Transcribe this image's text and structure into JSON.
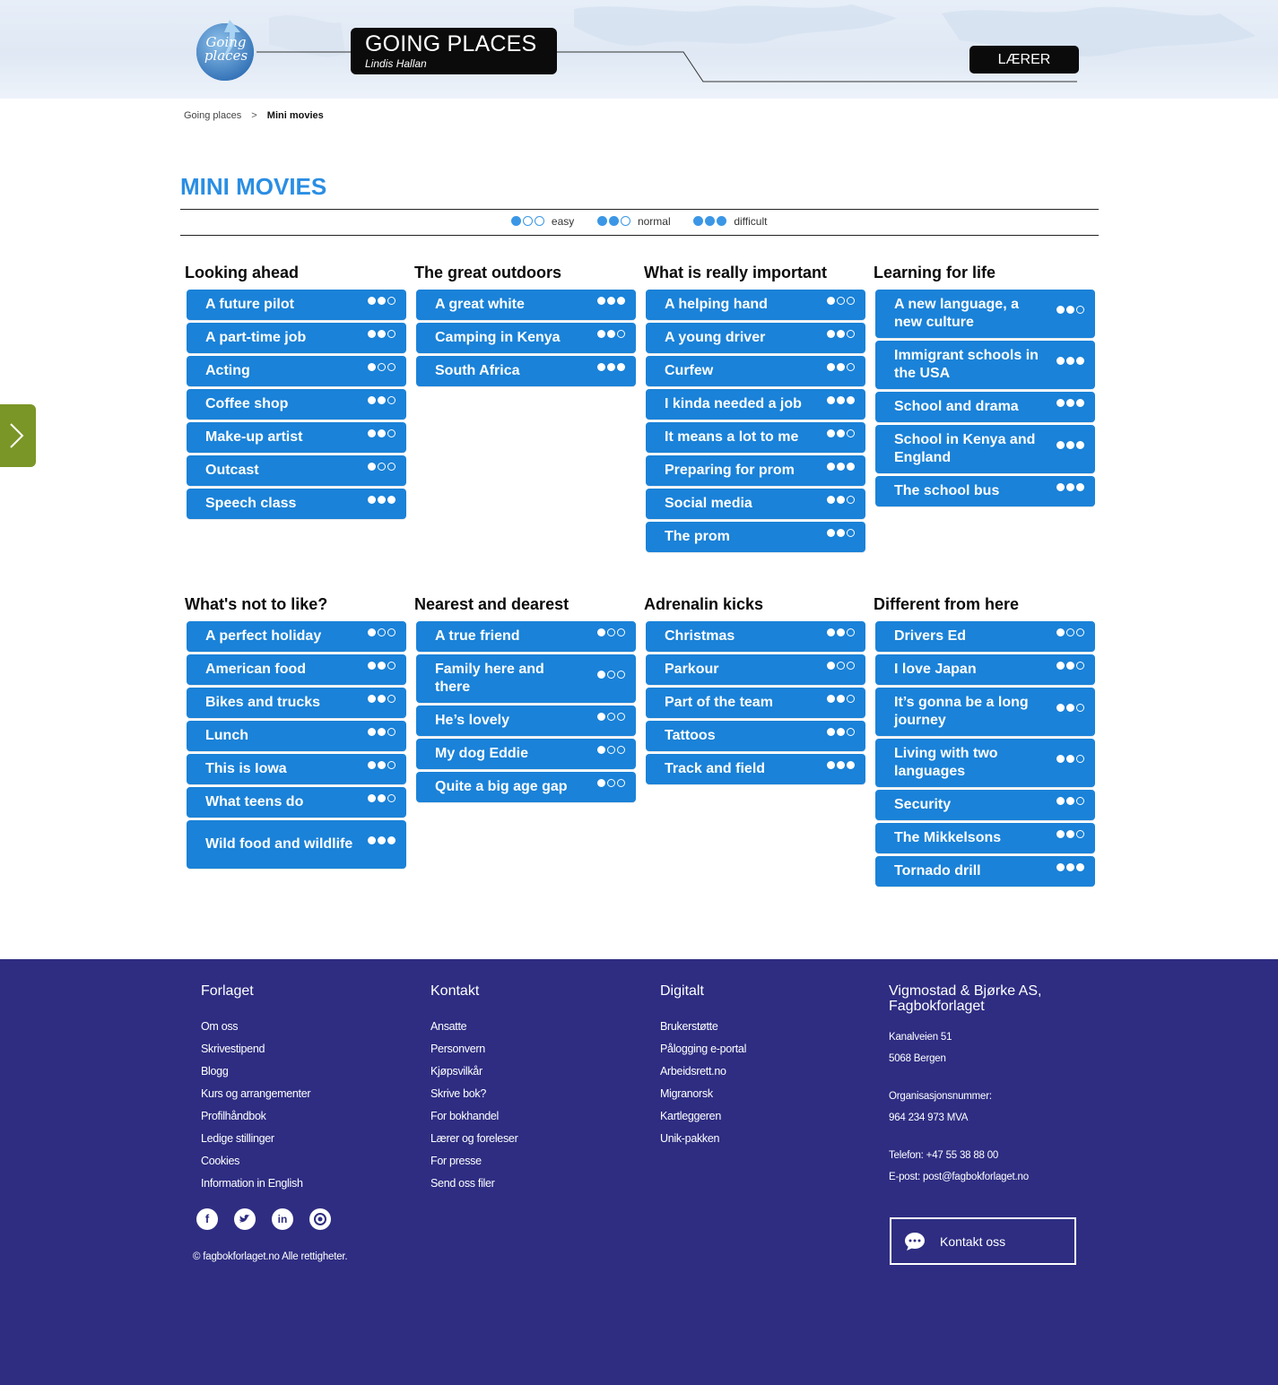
{
  "header": {
    "logo_text": "Going places",
    "title": "GOING PLACES",
    "author": "Lindis Hallan",
    "role_button": "LÆRER"
  },
  "breadcrumb": {
    "home": "Going places",
    "separator": ">",
    "current": "Mini movies"
  },
  "page_title": "MINI MOVIES",
  "legend": [
    {
      "level": 1,
      "label": "easy"
    },
    {
      "level": 2,
      "label": "normal"
    },
    {
      "level": 3,
      "label": "difficult"
    }
  ],
  "groups": [
    {
      "title": "Looking ahead",
      "items": [
        {
          "label": "A future pilot",
          "level": 2
        },
        {
          "label": "A part-time job",
          "level": 2
        },
        {
          "label": "Acting",
          "level": 1
        },
        {
          "label": "Coffee shop",
          "level": 2
        },
        {
          "label": "Make-up artist",
          "level": 2
        },
        {
          "label": "Outcast",
          "level": 1
        },
        {
          "label": "Speech class",
          "level": 3
        }
      ]
    },
    {
      "title": "The great outdoors",
      "items": [
        {
          "label": "A great white",
          "level": 3
        },
        {
          "label": "Camping in Kenya",
          "level": 2
        },
        {
          "label": "South Africa",
          "level": 3
        }
      ]
    },
    {
      "title": "What is really important",
      "items": [
        {
          "label": "A helping hand",
          "level": 1
        },
        {
          "label": "A young driver",
          "level": 2
        },
        {
          "label": "Curfew",
          "level": 2
        },
        {
          "label": "I kinda needed a job",
          "level": 3
        },
        {
          "label": "It means a lot to me",
          "level": 2
        },
        {
          "label": "Preparing for prom",
          "level": 3
        },
        {
          "label": "Social media",
          "level": 2
        },
        {
          "label": "The prom",
          "level": 2
        }
      ]
    },
    {
      "title": "Learning for life",
      "items": [
        {
          "label": "A new language, a new culture",
          "level": 2
        },
        {
          "label": "Immigrant schools in the USA",
          "level": 3
        },
        {
          "label": "School and drama",
          "level": 3
        },
        {
          "label": "School in Kenya and England",
          "level": 3
        },
        {
          "label": "The school bus",
          "level": 3
        }
      ]
    },
    {
      "title": "What's not to like?",
      "items": [
        {
          "label": "A perfect holiday",
          "level": 1
        },
        {
          "label": "American food",
          "level": 2
        },
        {
          "label": "Bikes and trucks",
          "level": 2
        },
        {
          "label": "Lunch",
          "level": 2
        },
        {
          "label": "This is Iowa",
          "level": 2
        },
        {
          "label": "What teens do",
          "level": 2
        },
        {
          "label": "Wild food and wildlife",
          "level": 3
        }
      ]
    },
    {
      "title": "Nearest and dearest",
      "items": [
        {
          "label": "A true friend",
          "level": 1
        },
        {
          "label": "Family here and there",
          "level": 1
        },
        {
          "label": "He’s lovely",
          "level": 1
        },
        {
          "label": "My dog Eddie",
          "level": 1
        },
        {
          "label": "Quite a big age gap",
          "level": 1
        }
      ]
    },
    {
      "title": "Adrenalin kicks",
      "items": [
        {
          "label": "Christmas",
          "level": 2
        },
        {
          "label": "Parkour",
          "level": 1
        },
        {
          "label": "Part of the team",
          "level": 2
        },
        {
          "label": "Tattoos",
          "level": 2
        },
        {
          "label": "Track and field",
          "level": 3
        }
      ]
    },
    {
      "title": "Different from here",
      "items": [
        {
          "label": "Drivers Ed",
          "level": 1
        },
        {
          "label": "I love Japan",
          "level": 2
        },
        {
          "label": "It’s gonna be a long journey",
          "level": 2
        },
        {
          "label": "Living with two languages",
          "level": 2
        },
        {
          "label": "Security",
          "level": 2
        },
        {
          "label": "The Mikkelsons",
          "level": 2
        },
        {
          "label": "Tornado drill",
          "level": 3
        }
      ]
    }
  ],
  "footer": {
    "columns": [
      {
        "title": "Forlaget",
        "links": [
          "Om oss",
          "Skrivestipend",
          "Blogg",
          "Kurs og arrangementer",
          "Profilhåndbok",
          "Ledige stillinger",
          "Cookies",
          "Information in English"
        ]
      },
      {
        "title": "Kontakt",
        "links": [
          "Ansatte",
          "Personvern",
          "Kjøpsvilkår",
          "Skrive bok?",
          "For bokhandel",
          "Lærer og foreleser",
          "For presse",
          "Send oss filer"
        ]
      },
      {
        "title": "Digitalt",
        "links": [
          "Brukerstøtte",
          "Pålogging e-portal",
          "Arbeidsrett.no",
          "Migranorsk",
          "Kartleggeren",
          "Unik-pakken"
        ]
      }
    ],
    "company": {
      "name": "Vigmostad & Bjørke AS, Fagbokforlaget",
      "address1": "Kanalveien 51",
      "address2": "5068 Bergen",
      "org_label": "Organisasjonsnummer:",
      "org_number": "964 234 973 MVA",
      "phone": "Telefon: +47 55 38 88 00",
      "email": "E-post: post@fagbokforlaget.no"
    },
    "social_icons": [
      "facebook-icon",
      "twitter-icon",
      "linkedin-icon",
      "instagram-icon"
    ],
    "copyright": "© fagbokforlaget.no Alle rettigheter.",
    "contact_button": "Kontakt oss"
  },
  "colors": {
    "accent": "#1a82d8",
    "title_blue": "#2a8ee3",
    "footer_bg": "#2e2d82",
    "side_tab": "#7a9626"
  }
}
